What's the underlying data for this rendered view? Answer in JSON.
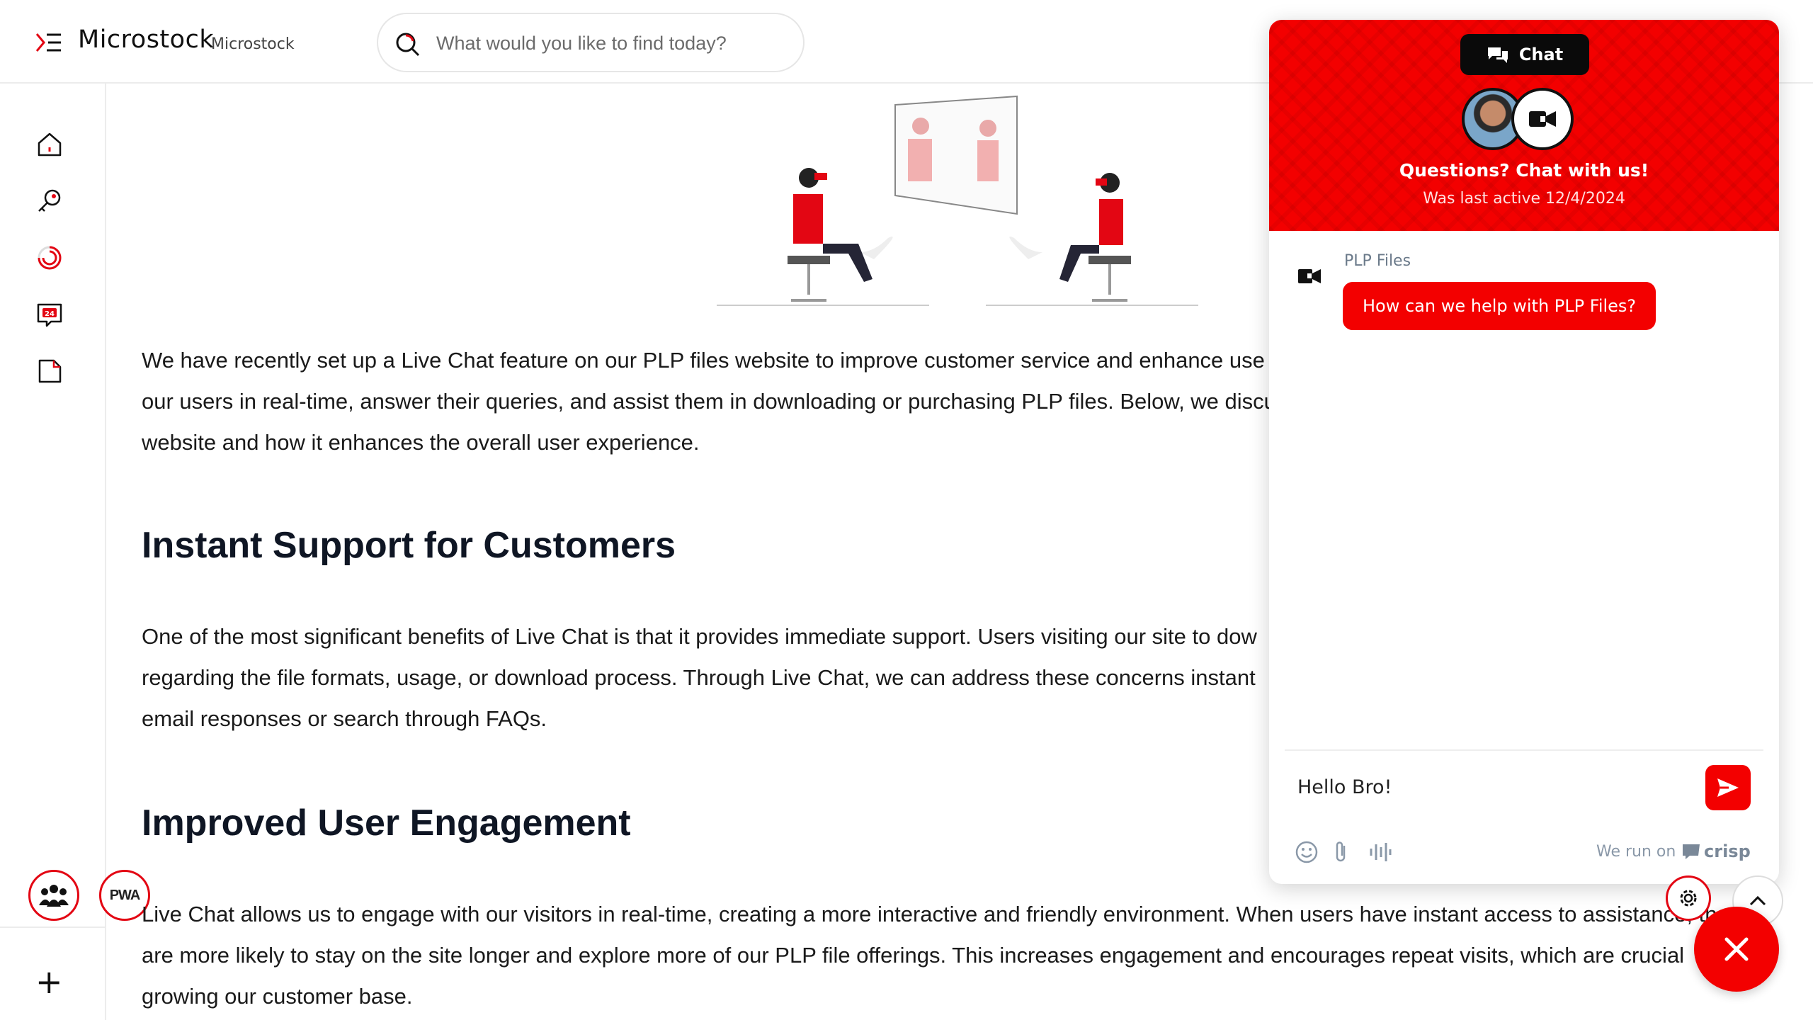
{
  "header": {
    "brand_name": "Microstock",
    "brand_sub": "Microstock",
    "search_placeholder": "What would you like to find today?"
  },
  "sidebar": {
    "items": [
      {
        "icon": "home-icon"
      },
      {
        "icon": "key-icon"
      },
      {
        "icon": "spinner-icon"
      },
      {
        "icon": "support-24-icon"
      },
      {
        "icon": "document-icon"
      }
    ],
    "pwa_label": "PWA",
    "plus_label": "+"
  },
  "article": {
    "intro": [
      "We have recently set up a Live Chat feature on our PLP files website to improve customer service and enhance use",
      "our users in real-time, answer their queries, and assist them in downloading or purchasing PLP files. Below, we discu",
      "website and how it enhances the overall user experience."
    ],
    "h1": "Instant Support for Customers",
    "p1": [
      "One of the most significant benefits of Live Chat is that it provides immediate support. Users visiting our site to dow",
      "regarding the file formats, usage, or download process. Through Live Chat, we can address these concerns instant",
      "email responses or search through FAQs."
    ],
    "h2": "Improved User Engagement",
    "p2": [
      "Live Chat allows us to engage with our visitors in real-time, creating a more interactive and friendly environment. When users have instant access to assistance, th",
      "are more likely to stay on the site longer and explore more of our PLP file offerings. This increases engagement and encourages repeat visits, which are crucial",
      "growing our customer base."
    ]
  },
  "chat": {
    "tab_label": "Chat",
    "headline": "Questions? Chat with us!",
    "last_active": "Was last active 12/4/2024",
    "sender": "PLP Files",
    "message": "How can we help with PLP Files?",
    "compose_value": "Hello Bro!",
    "run_on": "We run on",
    "crisp": "crisp",
    "accent": "#f30000"
  }
}
